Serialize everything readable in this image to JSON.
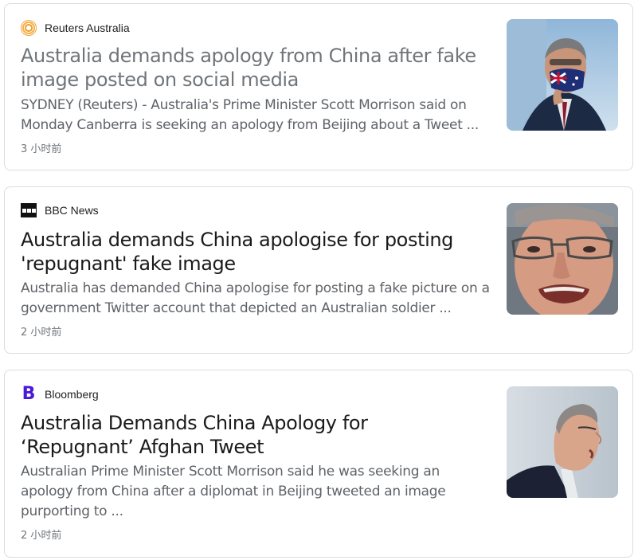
{
  "articles": [
    {
      "source": "Reuters Australia",
      "source_icon": "reuters-logo-icon",
      "title": "Australia demands apology from China after fake image posted on social media",
      "snippet": "SYDNEY (Reuters) - Australia's Prime Minister Scott Morrison said on Monday Canberra is seeking an apology from Beijing about a Tweet ...",
      "time": "3 小时前",
      "thumbnail": "man-with-flag-mask-photo"
    },
    {
      "source": "BBC News",
      "source_icon": "bbc-logo-icon",
      "title": "Australia demands China apologise for posting 'repugnant' fake image",
      "snippet": "Australia has demanded China apologise for posting a fake picture on a government Twitter account that depicted an Australian soldier ...",
      "time": "2 小时前",
      "thumbnail": "man-closeup-glasses-photo"
    },
    {
      "source": "Bloomberg",
      "source_icon": "bloomberg-logo-icon",
      "title": "Australia Demands China Apology for   ‘Repugnant’ Afghan Tweet",
      "snippet": "Australian Prime Minister Scott Morrison said he was seeking an apology from China after a diplomat in Beijing tweeted an image purporting to ...",
      "time": "2 小时前",
      "thumbnail": "man-speaking-profile-photo"
    }
  ],
  "colors": {
    "visited_title": "#70757a",
    "title": "#1a1a1a",
    "snippet": "#5f6368",
    "border": "#dadce0",
    "bloomberg_logo": "#4b19d8",
    "reuters_logo": "#f0a030"
  }
}
